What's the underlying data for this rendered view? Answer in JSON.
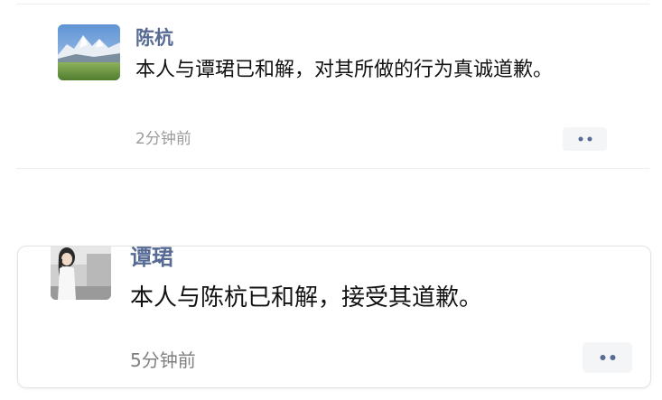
{
  "posts": [
    {
      "author": "陈杭",
      "text": "本人与谭珺已和解，对其所做的行为真诚道歉。",
      "time": "2分钟前",
      "avatar_icon": "mountain-landscape-avatar",
      "more_icon": "more-dots-icon"
    },
    {
      "author": "谭珺",
      "text": "本人与陈杭已和解，接受其道歉。",
      "time": "5分钟前",
      "avatar_icon": "person-photo-avatar",
      "more_icon": "more-dots-icon"
    }
  ],
  "colors": {
    "name": "#576b95",
    "text": "#111111",
    "time": "#9b9b9b",
    "more_bg": "#f4f5f7",
    "background": "#ffffff"
  }
}
